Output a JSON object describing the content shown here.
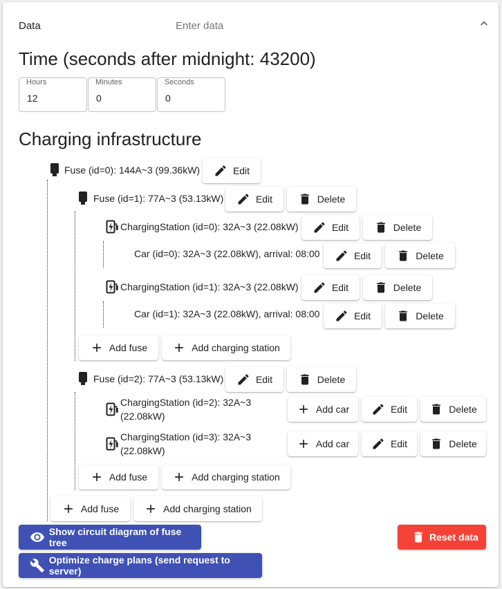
{
  "header": {
    "title": "Data",
    "subtitle": "Enter data"
  },
  "time": {
    "heading": "Time (seconds after midnight: 43200)",
    "hours_label": "Hours",
    "hours_value": "12",
    "minutes_label": "Minutes",
    "minutes_value": "0",
    "seconds_label": "Seconds",
    "seconds_value": "0"
  },
  "infra": {
    "heading": "Charging infrastructure"
  },
  "tree": {
    "fuse0": "Fuse (id=0): 144A~3 (99.36kW)",
    "fuse1": "Fuse (id=1): 77A~3 (53.13kW)",
    "cs0": "ChargingStation (id=0): 32A~3 (22.08kW)",
    "car0": "Car (id=0): 32A~3 (22.08kW), arrival: 08:00",
    "cs1": "ChargingStation (id=1): 32A~3 (22.08kW)",
    "car1": "Car (id=1): 32A~3 (22.08kW), arrival: 08:00",
    "fuse2": "Fuse (id=2): 77A~3 (53.13kW)",
    "cs2_line1": "ChargingStation (id=2): 32A~3",
    "cs2_line2": "(22.08kW)",
    "cs3_line1": "ChargingStation (id=3): 32A~3",
    "cs3_line2": "(22.08kW)"
  },
  "buttons": {
    "edit": "Edit",
    "delete": "Delete",
    "add_fuse": "Add fuse",
    "add_station": "Add charging station",
    "add_car": "Add car",
    "show_diagram": "Show circuit diagram of fuse tree",
    "reset": "Reset data",
    "optimize": "Optimize charge plans (send request to server)"
  },
  "colors": {
    "primary": "#3f51b5",
    "danger": "#f44336"
  }
}
